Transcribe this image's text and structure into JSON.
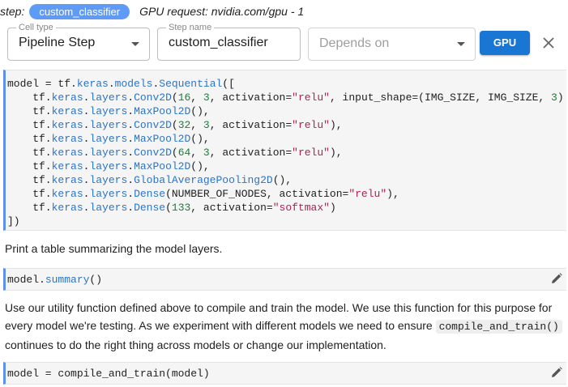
{
  "step": {
    "label": "step:",
    "name": "custom_classifier",
    "gpu_request": "GPU request: nvidia.com/gpu - 1"
  },
  "toolbar": {
    "cell_type": {
      "label": "Cell type",
      "value": "Pipeline Step"
    },
    "step_name": {
      "label": "Step name",
      "value": "custom_classifier"
    },
    "depends_on": {
      "placeholder": "Depends on"
    },
    "gpu_button": "GPU",
    "close_icon": "close-icon"
  },
  "cells": [
    {
      "lines": [
        [
          [
            "model = tf.",
            ""
          ],
          [
            "keras",
            "kw"
          ],
          [
            ".",
            ""
          ],
          [
            "models",
            "kw"
          ],
          [
            ".",
            ""
          ],
          [
            "Sequential",
            "kw"
          ],
          [
            "([",
            ""
          ]
        ],
        [
          [
            "    tf.",
            ""
          ],
          [
            "keras",
            "kw"
          ],
          [
            ".",
            ""
          ],
          [
            "layers",
            "kw"
          ],
          [
            ".",
            ""
          ],
          [
            "Conv2D",
            "kw"
          ],
          [
            "(",
            ""
          ],
          [
            "16",
            "num"
          ],
          [
            ", ",
            ""
          ],
          [
            "3",
            "num"
          ],
          [
            ", activation=",
            ""
          ],
          [
            "\"relu\"",
            "str"
          ],
          [
            ", input_shape=(IMG_SIZE, IMG_SIZE, ",
            ""
          ],
          [
            "3",
            "num"
          ],
          [
            ")",
            ""
          ]
        ],
        [
          [
            "    tf.",
            ""
          ],
          [
            "keras",
            "kw"
          ],
          [
            ".",
            ""
          ],
          [
            "layers",
            "kw"
          ],
          [
            ".",
            ""
          ],
          [
            "MaxPool2D",
            "kw"
          ],
          [
            "(),",
            ""
          ]
        ],
        [
          [
            "    tf.",
            ""
          ],
          [
            "keras",
            "kw"
          ],
          [
            ".",
            ""
          ],
          [
            "layers",
            "kw"
          ],
          [
            ".",
            ""
          ],
          [
            "Conv2D",
            "kw"
          ],
          [
            "(",
            ""
          ],
          [
            "32",
            "num"
          ],
          [
            ", ",
            ""
          ],
          [
            "3",
            "num"
          ],
          [
            ", activation=",
            ""
          ],
          [
            "\"relu\"",
            "str"
          ],
          [
            "),",
            ""
          ]
        ],
        [
          [
            "    tf.",
            ""
          ],
          [
            "keras",
            "kw"
          ],
          [
            ".",
            ""
          ],
          [
            "layers",
            "kw"
          ],
          [
            ".",
            ""
          ],
          [
            "MaxPool2D",
            "kw"
          ],
          [
            "(),",
            ""
          ]
        ],
        [
          [
            "    tf.",
            ""
          ],
          [
            "keras",
            "kw"
          ],
          [
            ".",
            ""
          ],
          [
            "layers",
            "kw"
          ],
          [
            ".",
            ""
          ],
          [
            "Conv2D",
            "kw"
          ],
          [
            "(",
            ""
          ],
          [
            "64",
            "num"
          ],
          [
            ", ",
            ""
          ],
          [
            "3",
            "num"
          ],
          [
            ", activation=",
            ""
          ],
          [
            "\"relu\"",
            "str"
          ],
          [
            "),",
            ""
          ]
        ],
        [
          [
            "    tf.",
            ""
          ],
          [
            "keras",
            "kw"
          ],
          [
            ".",
            ""
          ],
          [
            "layers",
            "kw"
          ],
          [
            ".",
            ""
          ],
          [
            "MaxPool2D",
            "kw"
          ],
          [
            "(),",
            ""
          ]
        ],
        [
          [
            "    tf.",
            ""
          ],
          [
            "keras",
            "kw"
          ],
          [
            ".",
            ""
          ],
          [
            "layers",
            "kw"
          ],
          [
            ".",
            ""
          ],
          [
            "GlobalAveragePooling2D",
            "kw"
          ],
          [
            "(),",
            ""
          ]
        ],
        [
          [
            "    tf.",
            ""
          ],
          [
            "keras",
            "kw"
          ],
          [
            ".",
            ""
          ],
          [
            "layers",
            "kw"
          ],
          [
            ".",
            ""
          ],
          [
            "Dense",
            "kw"
          ],
          [
            "(NUMBER_OF_NODES, activation=",
            ""
          ],
          [
            "\"relu\"",
            "str"
          ],
          [
            "),",
            ""
          ]
        ],
        [
          [
            "    tf.",
            ""
          ],
          [
            "keras",
            "kw"
          ],
          [
            ".",
            ""
          ],
          [
            "layers",
            "kw"
          ],
          [
            ".",
            ""
          ],
          [
            "Dense",
            "kw"
          ],
          [
            "(",
            ""
          ],
          [
            "133",
            "num"
          ],
          [
            ", activation=",
            ""
          ],
          [
            "\"softmax\"",
            "str"
          ],
          [
            ")",
            ""
          ]
        ],
        [
          [
            "])",
            ""
          ]
        ]
      ]
    },
    {
      "lines": [
        [
          [
            "model.",
            ""
          ],
          [
            "summary",
            "kw"
          ],
          [
            "()",
            ""
          ]
        ]
      ]
    },
    {
      "lines": [
        [
          [
            "model = compile_and_train(model)",
            ""
          ]
        ]
      ]
    }
  ],
  "markdown": {
    "summary_text": "Print a table summarizing the model layers.",
    "compile_text_before": "Use our utility function defined above to compile and train the model. We use this function for this purpose for every model we're testing. As we experiment with different models we need to ensure ",
    "compile_inline_code": "compile_and_train()",
    "compile_text_after": " continues to do the right thing across models or change our implementation."
  },
  "colors": {
    "accent": "#1976d2",
    "chip": "#5e9bf7",
    "cell_border": "#5b8ff0",
    "keyword": "#2b74c9",
    "number": "#1b7e3a",
    "string": "#b0224c"
  }
}
